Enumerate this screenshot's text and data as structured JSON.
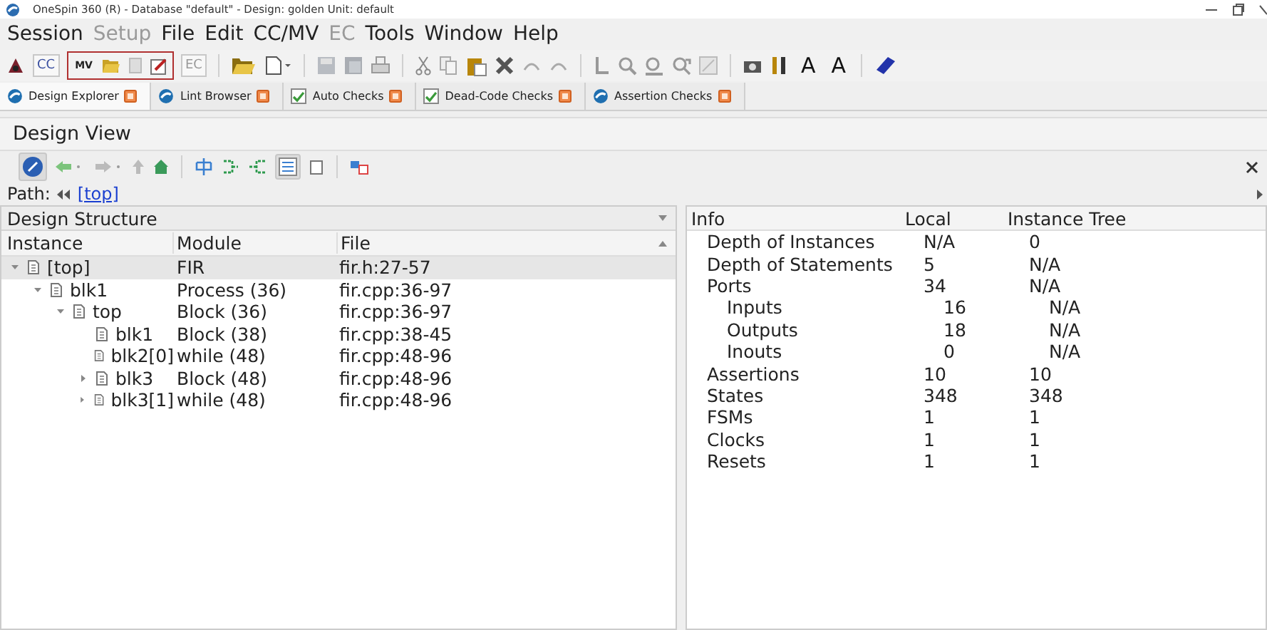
{
  "window": {
    "title": "OneSpin 360 (R) - Database \"default\" - Design: golden Unit: default"
  },
  "menu": [
    {
      "label": "Session",
      "disabled": false
    },
    {
      "label": "Setup",
      "disabled": true
    },
    {
      "label": "File",
      "disabled": false
    },
    {
      "label": "Edit",
      "disabled": false
    },
    {
      "label": "CC/MV",
      "disabled": false
    },
    {
      "label": "EC",
      "disabled": true
    },
    {
      "label": "Tools",
      "disabled": false
    },
    {
      "label": "Window",
      "disabled": false
    },
    {
      "label": "Help",
      "disabled": false
    }
  ],
  "toolbar": {
    "cc": "CC",
    "mv": "MV",
    "ec": "EC",
    "mv_group_highlighted": true,
    "font_up": "A",
    "font_down": "A"
  },
  "tabs": [
    {
      "label": "Design Explorer",
      "kind": "app",
      "selected": true
    },
    {
      "label": "Lint Browser",
      "kind": "app",
      "selected": false
    },
    {
      "label": "Auto Checks",
      "kind": "check",
      "selected": false
    },
    {
      "label": "Dead-Code Checks",
      "kind": "check",
      "selected": false
    },
    {
      "label": "Assertion Checks",
      "kind": "app",
      "selected": false
    }
  ],
  "view_title": "Design View",
  "path": {
    "label": "Path:",
    "link": "[top]"
  },
  "structure": {
    "title": "Design Structure",
    "columns": [
      "Instance",
      "Module",
      "File"
    ],
    "rows": [
      {
        "name": "[top]",
        "module": "FIR",
        "file": "fir.h:27-57",
        "selected": true,
        "expanded": true,
        "children": [
          {
            "name": "blk1",
            "module": "Process (36)",
            "file": "fir.cpp:36-97",
            "selected": false,
            "expanded": true,
            "children": [
              {
                "name": "top",
                "module": "Block (36)",
                "file": "fir.cpp:36-97",
                "selected": false,
                "expanded": true,
                "children": [
                  {
                    "name": "blk1",
                    "module": "Block (38)",
                    "file": "fir.cpp:38-45",
                    "selected": false
                  },
                  {
                    "name": "blk2[0]",
                    "module": "while (48)",
                    "file": "fir.cpp:48-96",
                    "selected": false
                  },
                  {
                    "name": "blk3",
                    "module": "Block (48)",
                    "file": "fir.cpp:48-96",
                    "selected": false,
                    "expanded": false
                  },
                  {
                    "name": "blk3[1]",
                    "module": "while (48)",
                    "file": "fir.cpp:48-96",
                    "selected": false,
                    "expanded": false
                  }
                ]
              }
            ]
          }
        ]
      }
    ]
  },
  "info": {
    "columns": [
      "Info",
      "Local",
      "Instance Tree"
    ],
    "rows": [
      {
        "name": "Depth of Instances",
        "local": "N/A",
        "tree": "0"
      },
      {
        "name": "Depth of Statements",
        "local": "5",
        "tree": "N/A"
      },
      {
        "name": "Ports",
        "local": "34",
        "tree": "N/A",
        "children": [
          {
            "name": "Inputs",
            "local": "16",
            "tree": "N/A"
          },
          {
            "name": "Outputs",
            "local": "18",
            "tree": "N/A"
          },
          {
            "name": "Inouts",
            "local": "0",
            "tree": "N/A"
          }
        ]
      },
      {
        "name": "Assertions",
        "local": "10",
        "tree": "10"
      },
      {
        "name": "States",
        "local": "348",
        "tree": "348"
      },
      {
        "name": "FSMs",
        "local": "1",
        "tree": "1"
      },
      {
        "name": "Clocks",
        "local": "1",
        "tree": "1"
      },
      {
        "name": "Resets",
        "local": "1",
        "tree": "1"
      }
    ]
  }
}
